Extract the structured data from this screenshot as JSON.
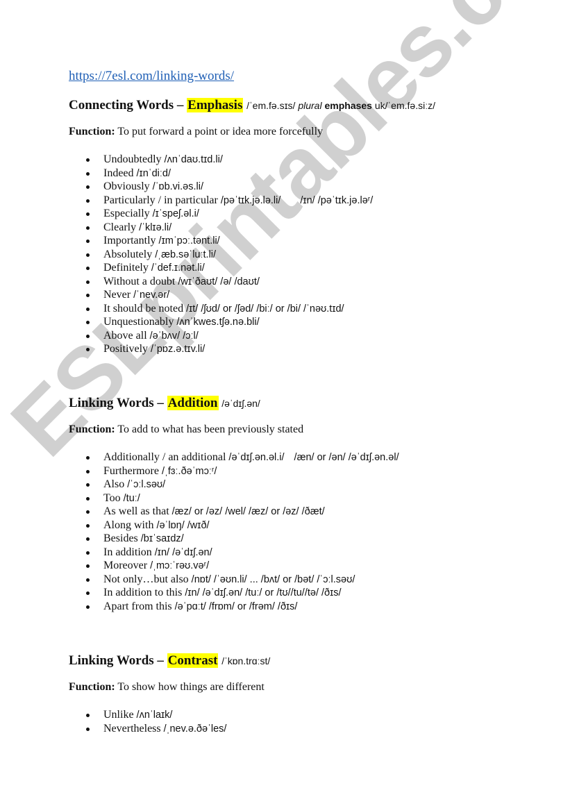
{
  "link": "https://7esl.com/linking-words/",
  "watermark": "ESLprintables.com",
  "sections": [
    {
      "heading_prefix": "Connecting Words – ",
      "heading_highlight": "Emphasis",
      "heading_ipa": "/ˈem.fə.sɪs/",
      "heading_plural_label": "plural",
      "heading_plural_word": "emphases",
      "heading_plural_ipa": "uk/ˈem.fə.siːz/",
      "function_label": "Function:",
      "function_text": "To put forward a point or idea more forcefully",
      "items": [
        {
          "word": "Undoubtedly",
          "ipa": "/ʌnˈdaʊ.tɪd.li/"
        },
        {
          "word": "Indeed",
          "ipa": "/ɪnˈdiːd/"
        },
        {
          "word": "Obviously",
          "ipa": "/ˈɒb.vi.əs.li/"
        },
        {
          "word": "Particularly / in particular",
          "ipa": "/pəˈtɪk.jə.lə.li/",
          "ipa2": "/ɪn/ /pəˈtɪk.jə.ləʳ/"
        },
        {
          "word": "Especially",
          "ipa": "/ɪˈspeʃ.əl.i/"
        },
        {
          "word": "Clearly",
          "ipa": "/ˈklɪə.li/"
        },
        {
          "word": "Importantly",
          "ipa": "/ɪmˈpɔː.tənt.li/"
        },
        {
          "word": "Absolutely",
          "ipa": "/ˌæb.səˈluːt.li/"
        },
        {
          "word": "Definitely",
          "ipa": "/ˈdef.ɪ.nət.li/"
        },
        {
          "word": "Without a doubt",
          "ipa": "/wɪˈðaʊt/ /ə/ /daʊt/"
        },
        {
          "word": "Never",
          "ipa": "/ˈnev.ər/"
        },
        {
          "word": "It should be noted",
          "ipa": "/ɪt/ /ʃʊd/ or /ʃəd/ /biː/ or /bi/ /ˈnəʊ.tɪd/"
        },
        {
          "word": "Unquestionably",
          "ipa": "/ʌnˈkwes.tʃə.nə.bli/"
        },
        {
          "word": "Above all",
          "ipa": "/əˈbʌv/ /ɔːl/"
        },
        {
          "word": "Positively",
          "ipa": "/ˈpɒz.ə.tɪv.li/"
        }
      ]
    },
    {
      "heading_prefix": "Linking Words – ",
      "heading_highlight": "Addition",
      "heading_ipa": "/əˈdɪʃ.ən/",
      "function_label": "Function:",
      "function_text": "To add to what has been previously stated",
      "items": [
        {
          "word": "Additionally / an additional",
          "ipa": "/əˈdɪʃ.ən.əl.i/",
          "ipa2": "/æn/ or /ən/ /əˈdɪʃ.ən.əl/"
        },
        {
          "word": "Furthermore",
          "ipa": "/ˌfɜː.ðəˈmɔːʳ/"
        },
        {
          "word": "Also",
          "ipa": "/ˈɔːl.səʊ/"
        },
        {
          "word": "Too",
          "ipa": "/tuː/"
        },
        {
          "word": "As well as that",
          "ipa": "/æz/ or /əz/ /wel/ /æz/ or /əz/ /ðæt/"
        },
        {
          "word": "Along with",
          "ipa": "/əˈlɒŋ/ /wɪð/"
        },
        {
          "word": "Besides",
          "ipa": "/bɪˈsaɪdz/"
        },
        {
          "word": "In addition",
          "ipa": "/ɪn/ /əˈdɪʃ.ən/"
        },
        {
          "word": "Moreover",
          "ipa": "/ˌmɔːˈrəʊ.vəʳ/"
        },
        {
          "word": "Not only…but also",
          "ipa": "/nɒt/ /ˈəʊn.li/ ... /bʌt/ or /bət/ /ˈɔːl.səʊ/"
        },
        {
          "word": "In addition to this",
          "ipa": "/ɪn/ /əˈdɪʃ.ən/ /tuː/ or /tʊ//tu//tə/ /ðɪs/"
        },
        {
          "word": "Apart from this",
          "ipa": "/əˈpɑːt/ /frɒm/ or /frəm/ /ðɪs/"
        }
      ]
    },
    {
      "heading_prefix": "Linking Words – ",
      "heading_highlight": "Contrast",
      "heading_ipa": "/ˈkɒn.trɑːst/",
      "function_label": "Function:",
      "function_text": "To show how things are different",
      "items": [
        {
          "word": "Unlike",
          "ipa": "/ʌnˈlaɪk/"
        },
        {
          "word": "Nevertheless",
          "ipa": "/ˌnev.ə.ðəˈles/"
        }
      ]
    }
  ]
}
